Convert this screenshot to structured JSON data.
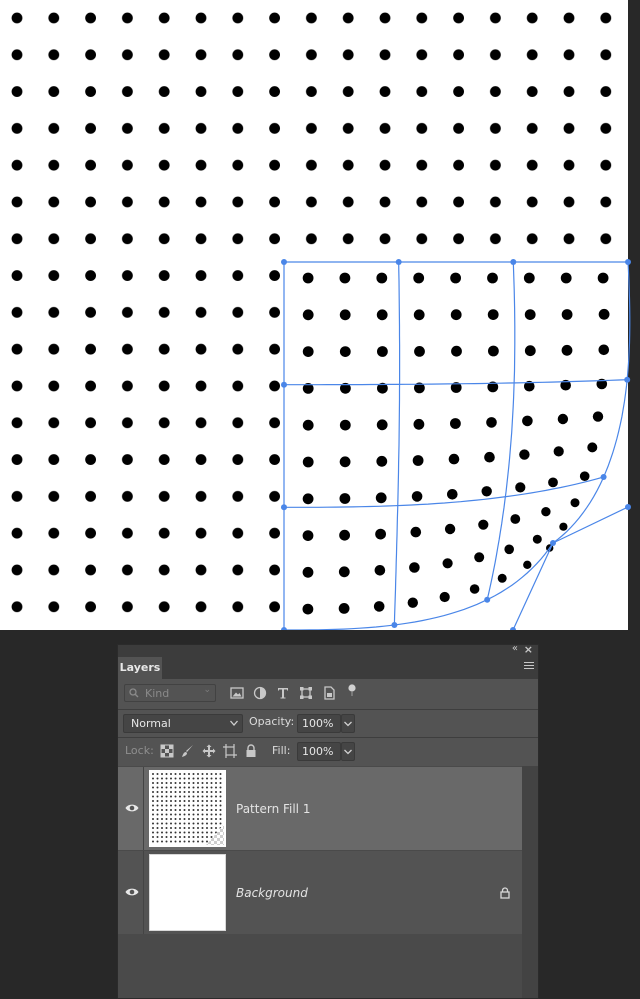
{
  "canvas": {
    "dot_pattern": {
      "dot_color": "#000000",
      "background": "#ffffff"
    },
    "warp_selection": {
      "color": "#4a86e8"
    }
  },
  "layers_panel": {
    "tab_label": "Layers",
    "filter": {
      "kind_label": "Kind",
      "icons": [
        "image-filter-icon",
        "adjustment-filter-icon",
        "type-filter-icon",
        "shape-filter-icon",
        "smart-object-filter-icon",
        "filter-toggle-icon"
      ]
    },
    "blend_mode": "Normal",
    "opacity_label": "Opacity:",
    "opacity_value": "100%",
    "lock_label": "Lock:",
    "fill_label": "Fill:",
    "fill_value": "100%",
    "layers": [
      {
        "name": "Pattern Fill 1",
        "selected": true
      },
      {
        "name": "Background",
        "selected": false,
        "locked": true
      }
    ]
  }
}
